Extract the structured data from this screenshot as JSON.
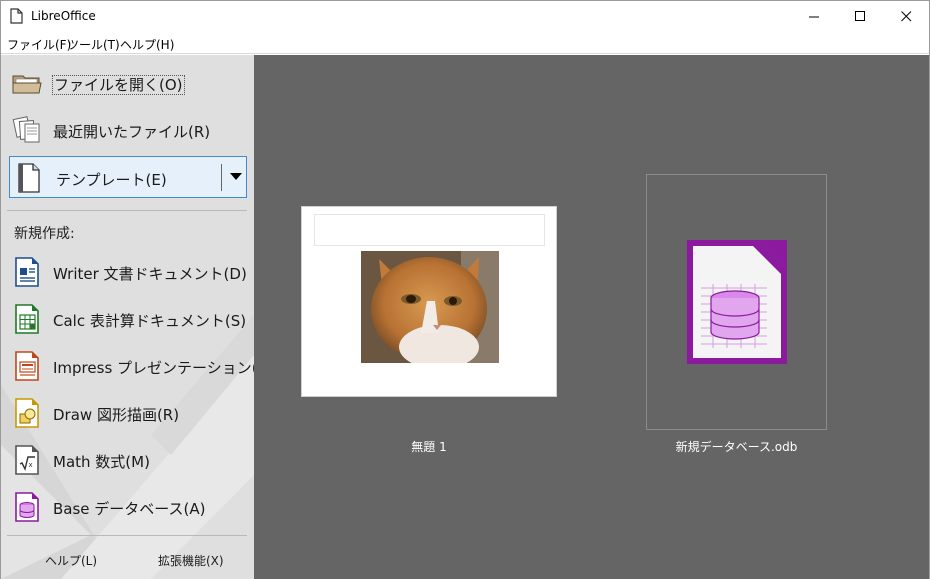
{
  "window": {
    "title": "LibreOffice",
    "controls": [
      "minimize-icon",
      "maximize-icon",
      "close-icon"
    ]
  },
  "menubar": {
    "items": [
      {
        "label": "ファイル(F)"
      },
      {
        "label": "ツール(T)"
      },
      {
        "label": "ヘルプ(H)"
      }
    ]
  },
  "sidebar": {
    "open_file": "ファイルを開く(O)",
    "recent_files": "最近開いたファイル(R)",
    "templates": "テンプレート(E)",
    "create_label": "新規作成:",
    "create_items": [
      {
        "label": "Writer 文書ドキュメント(D)",
        "icon": "writer-icon",
        "color": "#1f4e8c"
      },
      {
        "label": "Calc 表計算ドキュメント(S)",
        "icon": "calc-icon",
        "color": "#1e7a25"
      },
      {
        "label": "Impress プレゼンテーション(P)",
        "icon": "impress-icon",
        "color": "#c0471b"
      },
      {
        "label": "Draw 図形描画(R)",
        "icon": "draw-icon",
        "color": "#c79a00"
      },
      {
        "label": "Math 数式(M)",
        "icon": "math-icon",
        "color": "#555555"
      },
      {
        "label": "Base データベース(A)",
        "icon": "base-icon",
        "color": "#8b1a9e"
      }
    ],
    "help": "ヘルプ(L)",
    "extensions": "拡張機能(X)"
  },
  "recent_documents": [
    {
      "name": "無題 1",
      "type": "writer-document-thumbnail"
    },
    {
      "name": "新規データベース.odb",
      "type": "base-database-thumbnail"
    }
  ],
  "colors": {
    "sidebar_bg": "#dfdfdf",
    "main_bg": "#656565",
    "selection_border": "#3d8cd0",
    "base_purple": "#8b1a9e"
  }
}
